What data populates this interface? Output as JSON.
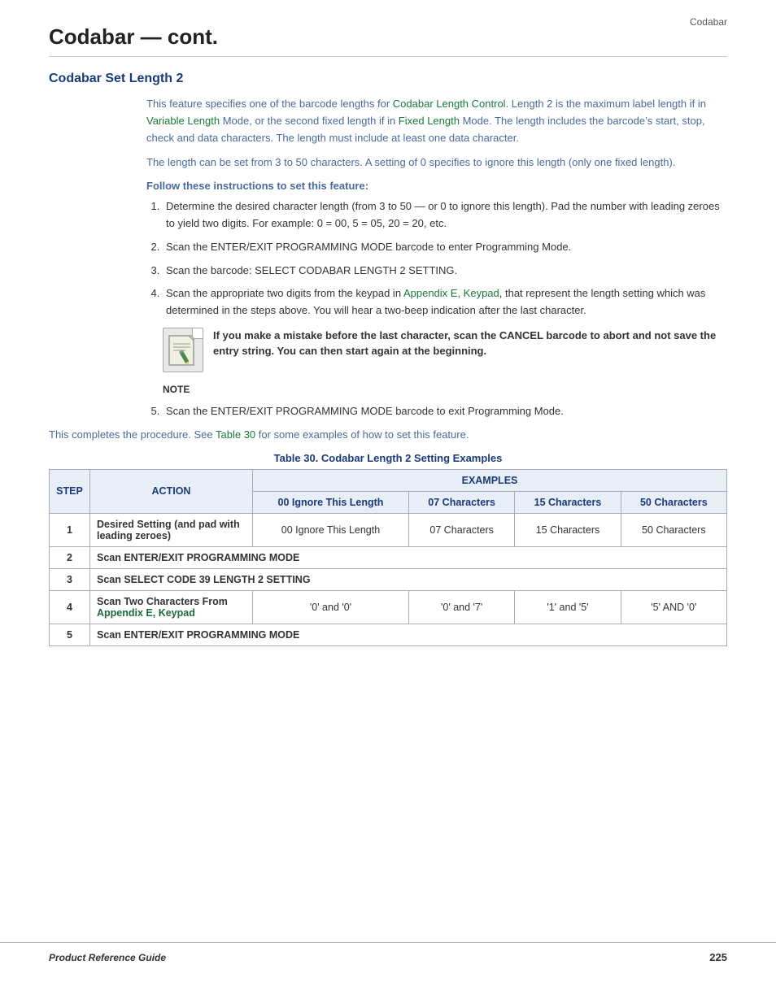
{
  "page": {
    "top_label": "Codabar",
    "main_title": "Codabar — cont.",
    "section_title": "Codabar Set Length 2",
    "body_paragraph1": "This feature specifies one of the barcode lengths for ",
    "body_link1": "Codabar Length Control",
    "body_paragraph1b": ". Length 2 is the maximum label length if in ",
    "body_link2": "Variable Length",
    "body_paragraph1c": " Mode, or the second fixed length if in ",
    "body_link3": "Fixed Length",
    "body_paragraph1d": " Mode. The length includes the barcode’s start, stop, check and data characters.  The length must include at least one data character.",
    "body_paragraph2": "The length can be set from 3 to 50 characters. A setting of 0 specifies to ignore this length (only one fixed length).",
    "instructions_header": "Follow these instructions to set this feature:",
    "steps": [
      "Determine the desired character length (from 3 to 50 — or 0 to ignore this length). Pad the number with leading zeroes to yield two digits. For example: 0 = 00, 5 = 05, 20 = 20, etc.",
      "Scan the ENTER/EXIT PROGRAMMING MODE barcode to enter Programming Mode.",
      "Scan the barcode: SELECT CODABAR LENGTH 2 SETTING.",
      "Scan the appropriate two digits from the keypad in Appendix E, Keypad, that represent the length setting which was determined in the steps above. You will hear a two-beep indication after the last character."
    ],
    "step4_link": "Appendix E, Keypad",
    "note_text": "If you make a mistake before the last character, scan the CANCEL barcode to abort and not save the entry string. You can then start again at the beginning.",
    "note_label": "NOTE",
    "step5": "Scan the ENTER/EXIT PROGRAMMING MODE barcode to exit Programming Mode.",
    "completion_text_before": "This completes the procedure. See ",
    "completion_link": "Table 30",
    "completion_text_after": " for some examples of how to set this feature.",
    "table_title": "Table 30. Codabar Length 2 Setting Examples",
    "table": {
      "headers": [
        "STEP",
        "ACTION",
        "EXAMPLES",
        "",
        "",
        ""
      ],
      "col_headers": [
        "STEP",
        "ACTION",
        "00 Ignore This Length",
        "07 Characters",
        "15 Characters",
        "50 Characters"
      ],
      "rows": [
        {
          "step": "1",
          "action": "Desired Setting (and pad with leading zeroes)",
          "ex1": "00 Ignore This Length",
          "ex2": "07 Characters",
          "ex3": "15 Characters",
          "ex4": "50 Characters"
        },
        {
          "step": "2",
          "action": "Scan ENTER/EXIT PROGRAMMING MODE",
          "span": true
        },
        {
          "step": "3",
          "action": "Scan SELECT CODE 39 LENGTH 2 SETTING",
          "span": true
        },
        {
          "step": "4",
          "action": "Scan Two Characters From Appendix E, Keypad",
          "action_link": "Appendix E, Keypad",
          "ex1": "'0' and '0'",
          "ex2": "'0' and '7'",
          "ex3": "'1' and '5'",
          "ex4": "'5' AND '0'"
        },
        {
          "step": "5",
          "action": "Scan ENTER/EXIT PROGRAMMING MODE",
          "span": true
        }
      ]
    },
    "footer": {
      "left": "Product Reference Guide",
      "right": "225"
    }
  }
}
